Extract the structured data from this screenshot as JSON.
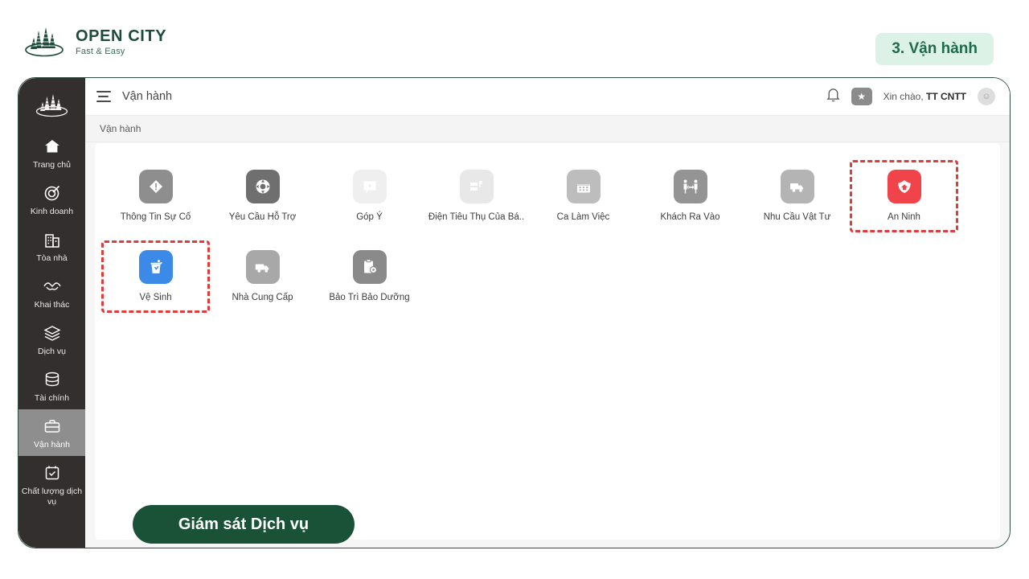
{
  "brand": {
    "title": "OPEN CITY",
    "subtitle": "Fast & Easy",
    "logo_icon": "city-skyline-icon",
    "color": "#1d4b3c"
  },
  "step_badge": {
    "label": "3. Vận hành",
    "bg": "#ddf2e6",
    "fg": "#1d6b4a"
  },
  "sidebar": {
    "logo_icon": "city-skyline-icon",
    "items": [
      {
        "label": "Trang chủ",
        "icon": "home-icon",
        "active": false
      },
      {
        "label": "Kinh doanh",
        "icon": "target-icon",
        "active": false
      },
      {
        "label": "Tòa nhà",
        "icon": "building-icon",
        "active": false
      },
      {
        "label": "Khai thác",
        "icon": "handshake-icon",
        "active": false
      },
      {
        "label": "Dịch vụ",
        "icon": "layers-icon",
        "active": false
      },
      {
        "label": "Tài chính",
        "icon": "database-icon",
        "active": false
      },
      {
        "label": "Vận hành",
        "icon": "briefcase-icon",
        "active": true
      },
      {
        "label": "Chất lượng dịch vụ",
        "icon": "calendar-check-icon",
        "active": false
      }
    ]
  },
  "topbar": {
    "menu_icon": "hamburger-icon",
    "title": "Vận hành",
    "bell_icon": "bell-icon",
    "star_icon": "star-icon",
    "greeting_prefix": "Xin chào, ",
    "user_name": "TT CNTT",
    "avatar_icon": "avatar-icon"
  },
  "breadcrumb": {
    "text": "Vận hành"
  },
  "tiles": [
    {
      "label": "Thông Tin Sự Cố",
      "icon": "warning-diamond-icon",
      "bg": "#8e8e8e",
      "highlight": false
    },
    {
      "label": "Yêu Cầu Hỗ Trợ",
      "icon": "lifebuoy-icon",
      "bg": "#6f6f6f",
      "highlight": false
    },
    {
      "label": "Góp Ý",
      "icon": "feedback-icon",
      "bg": "#efefef",
      "highlight": false
    },
    {
      "label": "Điện Tiêu Thụ Của Bá..",
      "icon": "meter-icon",
      "bg": "#e8e8e8",
      "highlight": false
    },
    {
      "label": "Ca Làm Việc",
      "icon": "calendar-icon",
      "bg": "#bdbdbd",
      "highlight": false
    },
    {
      "label": "Khách Ra Vào",
      "icon": "visitors-icon",
      "bg": "#949494",
      "highlight": false
    },
    {
      "label": "Nhu Cầu Vật Tư",
      "icon": "truck-icon",
      "bg": "#b4b4b4",
      "highlight": false
    },
    {
      "label": "An Ninh",
      "icon": "security-shield-icon",
      "bg": "#f0444a",
      "highlight": true
    },
    {
      "label": "Vệ Sinh",
      "icon": "cleaning-bin-icon",
      "bg": "#3b8ae8",
      "highlight": true
    },
    {
      "label": "Nhà Cung Cấp",
      "icon": "supplier-truck-icon",
      "bg": "#a8a8a8",
      "highlight": false
    },
    {
      "label": "Bảo Trì Bảo Dưỡng",
      "icon": "maintenance-icon",
      "bg": "#8a8a8a",
      "highlight": false
    }
  ],
  "cta": {
    "label": "Giám sát Dịch vụ",
    "bg": "#1a5238",
    "fg": "#ffffff"
  }
}
